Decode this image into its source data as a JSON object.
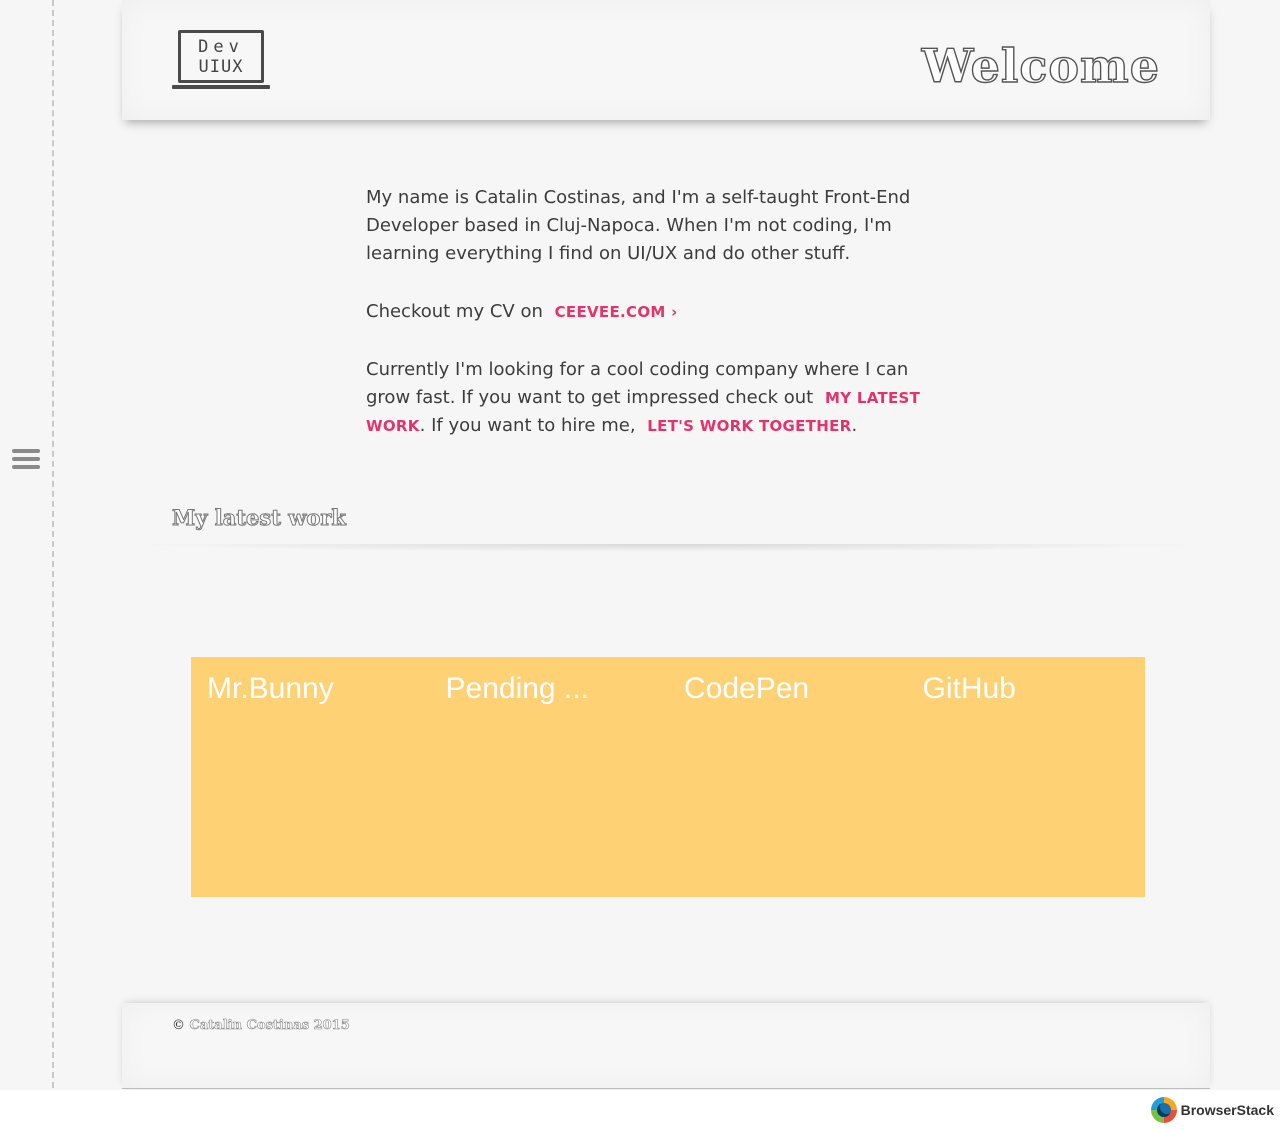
{
  "header": {
    "logo_line1": "Dev",
    "logo_line2": "UIUX",
    "title": "Welcome"
  },
  "intro": {
    "p1": "My name is Catalin Costinas, and I'm a self-taught Front-End Developer based in Cluj-Napoca. When I'm not coding, I'm learning everything I find on UI/UX and do other stuff.",
    "p2_prefix": "Checkout my CV on",
    "cv_link": "ceevee.com ›",
    "p3_part1": "Currently I'm looking for a cool coding company where I can grow fast. If you want to get impressed check out",
    "work_link": "my latest work",
    "p3_part2": ". If you want to hire me,",
    "hire_link": "let's work together",
    "p3_end": "."
  },
  "latest_work": {
    "title": "My latest work",
    "items": [
      "Mr.Bunny",
      "Pending ...",
      "CodePen",
      "GitHub"
    ]
  },
  "footer": {
    "symbol": "©",
    "text": "Catalin Costinas 2015"
  },
  "badge": {
    "label": "BrowserStack"
  },
  "colors": {
    "accent": "#e4336b",
    "work_bg": "#fed175",
    "page_bg": "#f6f6f6"
  }
}
